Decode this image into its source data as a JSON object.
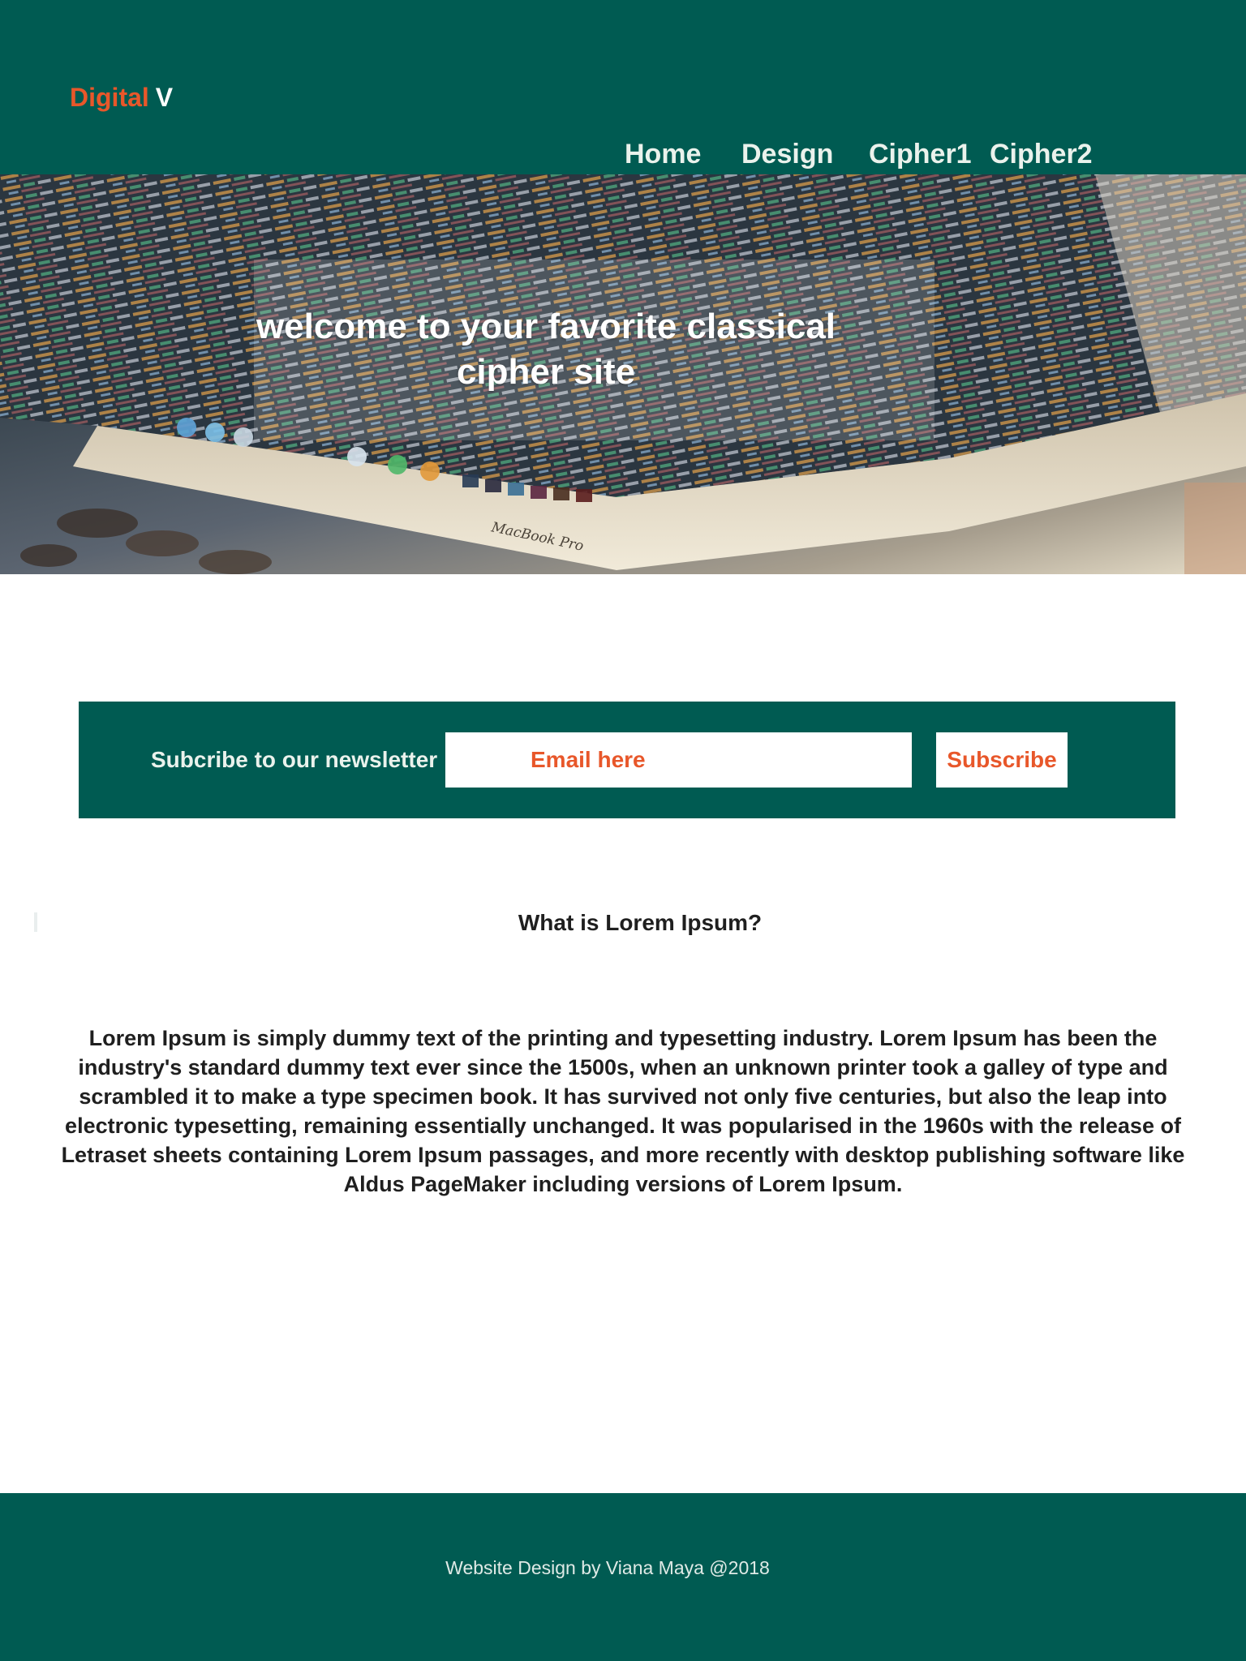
{
  "header": {
    "logo_primary": "Digital",
    "logo_secondary": "V",
    "nav": [
      {
        "label": "Home"
      },
      {
        "label": "Design"
      },
      {
        "label": "Cipher1"
      },
      {
        "label": "Cipher2"
      }
    ]
  },
  "hero": {
    "title": "welcome to your favorite classical cipher site",
    "screen_label": "MacBook Pro"
  },
  "newsletter": {
    "label": "Subcribe to our newsletter",
    "email_placeholder": "Email here",
    "button_label": "Subscribe"
  },
  "content": {
    "heading": "What is Lorem Ipsum?",
    "body": "Lorem Ipsum is simply dummy text of the printing and typesetting industry. Lorem Ipsum has been the industry's standard dummy text ever since the 1500s, when an unknown printer took a galley of type and scrambled it to make a type specimen book. It has survived not only five centuries, but also the leap into electronic typesetting, remaining essentially unchanged. It was popularised in the 1960s with the release of Letraset sheets containing Lorem Ipsum passages, and more recently with desktop publishing software like Aldus PageMaker including versions of Lorem Ipsum."
  },
  "footer": {
    "credit": "Website Design by Viana Maya @2018"
  },
  "colors": {
    "brand_green": "#005b52",
    "accent_orange": "#e8572a",
    "text_dark": "#1f1f1f",
    "white": "#ffffff"
  }
}
